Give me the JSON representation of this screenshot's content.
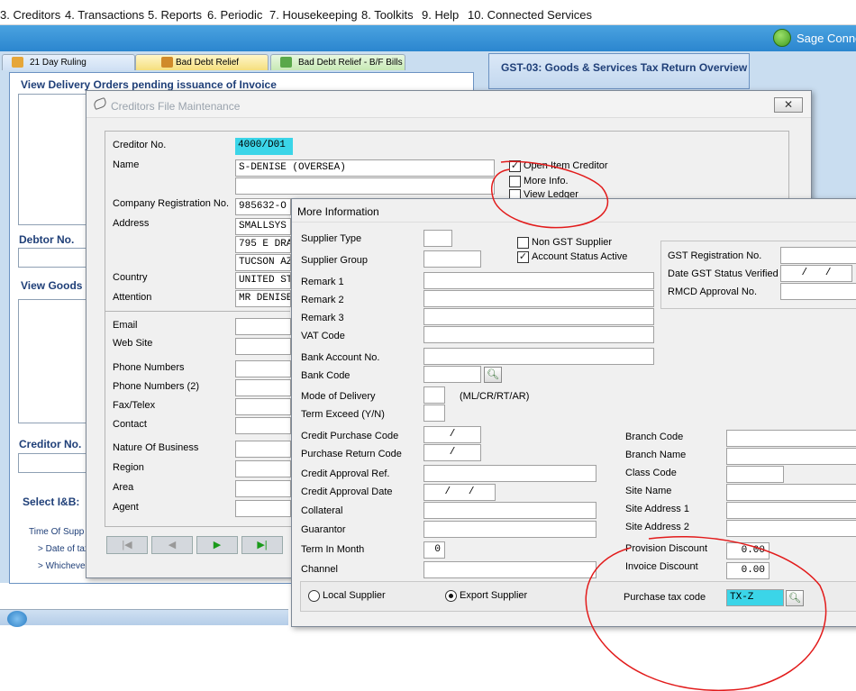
{
  "menu": [
    "3. Creditors",
    "4. Transactions",
    "5. Reports",
    "6. Periodic",
    "7. Housekeeping",
    "8. Toolkits",
    "9. Help",
    "10. Connected Services"
  ],
  "toolbar": {
    "sage_label": "Sage Conne"
  },
  "tabs": [
    "21 Day Ruling",
    "Bad Debt Relief",
    "Bad Debt Relief - B/F Bills"
  ],
  "gst_panel": {
    "title": "GST-03: Goods & Services Tax Return Overview"
  },
  "left_panel": {
    "view_delivery": "View Delivery Orders pending issuance of Invoice",
    "debtor_no": "Debtor No.",
    "view_goods": "View Goods",
    "creditor_no": "Creditor No.",
    "select_ib": "Select I&B:",
    "time_of_supp": "Time Of Supp",
    "date_of_tax": "> Date of tax",
    "whichever": "> Whichever"
  },
  "creditors_dialog": {
    "title": "Creditors File Maintenance",
    "labels": {
      "creditor_no": "Creditor No.",
      "name": "Name",
      "company_reg": "Company Registration No.",
      "address": "Address",
      "country": "Country",
      "attention": "Attention",
      "email": "Email",
      "website": "Web Site",
      "phone": "Phone Numbers",
      "phone2": "Phone Numbers (2)",
      "fax": "Fax/Telex",
      "contact": "Contact",
      "nature": "Nature Of Business",
      "region": "Region",
      "area": "Area",
      "agent": "Agent"
    },
    "values": {
      "creditor_no": "4000/D01",
      "name": "S-DENISE (OVERSEA)",
      "company_reg": "985632-O",
      "address1": "SMALLSYS",
      "address2": "795 E DRA",
      "address3": "TUCSON AZ",
      "country": "UNITED ST",
      "attention": "MR DENISE"
    },
    "checks": {
      "open_item": "Open Item Creditor",
      "more_info": "More Info.",
      "view_ledger": "View Ledger"
    }
  },
  "more_info": {
    "title": "More Information",
    "labels": {
      "supplier_type": "Supplier Type",
      "supplier_group": "Supplier Group",
      "remark1": "Remark 1",
      "remark2": "Remark 2",
      "remark3": "Remark 3",
      "vat_code": "VAT Code",
      "bank_account": "Bank Account No.",
      "bank_code": "Bank Code",
      "mode_delivery": "Mode of Delivery",
      "mode_hint": "(ML/CR/RT/AR)",
      "term_exceed": "Term Exceed (Y/N)",
      "credit_purchase": "Credit Purchase Code",
      "purchase_return": "Purchase Return Code",
      "credit_approval_ref": "Credit Approval Ref.",
      "credit_approval_date": "Credit Approval Date",
      "collateral": "Collateral",
      "guarantor": "Guarantor",
      "term_month": "Term In Month",
      "channel": "Channel",
      "non_gst": "Non GST Supplier",
      "account_active": "Account Status Active",
      "gst_reg": "GST Registration No.",
      "date_gst": "Date GST Status Verified",
      "rmcd": "RMCD Approval No.",
      "branch_code": "Branch Code",
      "branch_name": "Branch Name",
      "class_code": "Class Code",
      "site_name": "Site Name",
      "site_addr1": "Site Address 1",
      "site_addr2": "Site Address 2",
      "provision_discount": "Provision Discount",
      "invoice_discount": "Invoice Discount",
      "purchase_tax_code": "Purchase tax code",
      "local_supplier": "Local Supplier",
      "export_supplier": "Export Supplier"
    },
    "values": {
      "credit_purchase": "/",
      "purchase_return": "/",
      "credit_approval_date": "/   /",
      "date_gst": "/   /",
      "term_month": "0",
      "provision_discount": "0.00",
      "invoice_discount": "0.00",
      "purchase_tax_code": "TX-Z"
    }
  }
}
